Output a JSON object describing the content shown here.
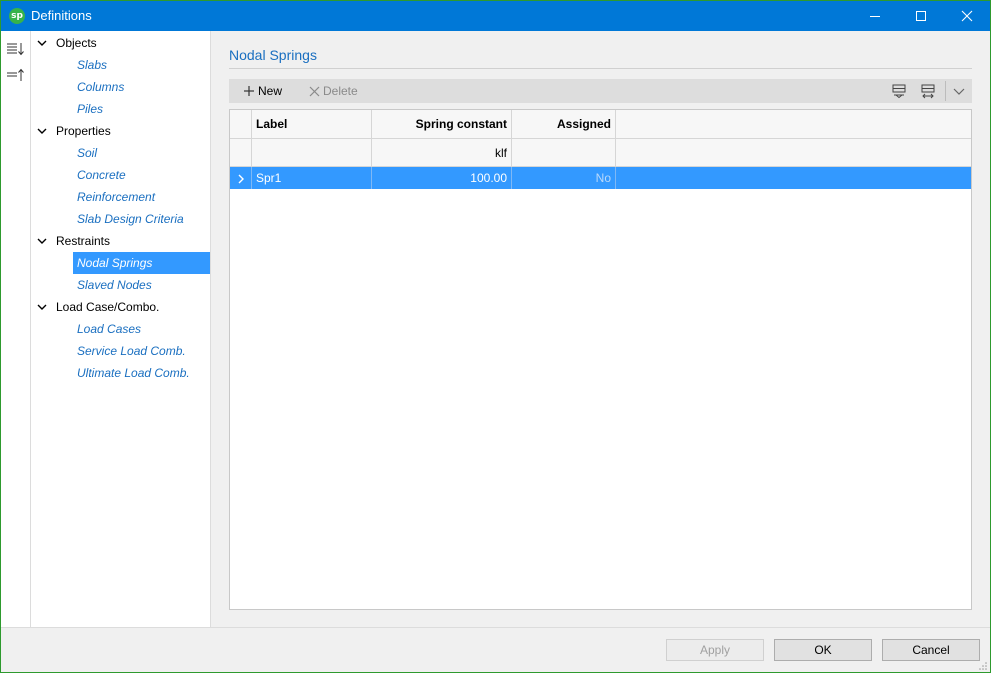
{
  "window": {
    "title": "Definitions",
    "app_icon_text": "sp"
  },
  "tree": {
    "groups": [
      {
        "label": "Objects",
        "children": [
          "Slabs",
          "Columns",
          "Piles"
        ]
      },
      {
        "label": "Properties",
        "children": [
          "Soil",
          "Concrete",
          "Reinforcement",
          "Slab Design Criteria"
        ]
      },
      {
        "label": "Restraints",
        "children": [
          "Nodal Springs",
          "Slaved Nodes"
        ]
      },
      {
        "label": "Load Case/Combo.",
        "children": [
          "Load Cases",
          "Service Load Comb.",
          "Ultimate Load Comb."
        ]
      }
    ],
    "selected": "Nodal Springs"
  },
  "main": {
    "title": "Nodal Springs",
    "toolbar": {
      "new_label": "New",
      "delete_label": "Delete"
    },
    "grid": {
      "columns": [
        "Label",
        "Spring constant",
        "Assigned"
      ],
      "units": [
        "",
        "klf",
        ""
      ],
      "rows": [
        {
          "label": "Spr1",
          "spring_constant": "100.00",
          "assigned": "No"
        }
      ]
    }
  },
  "footer": {
    "apply_label": "Apply",
    "ok_label": "OK",
    "cancel_label": "Cancel"
  },
  "colors": {
    "titlebar": "#0078d7",
    "selection": "#3399ff",
    "link_text": "#1a6fc0"
  }
}
